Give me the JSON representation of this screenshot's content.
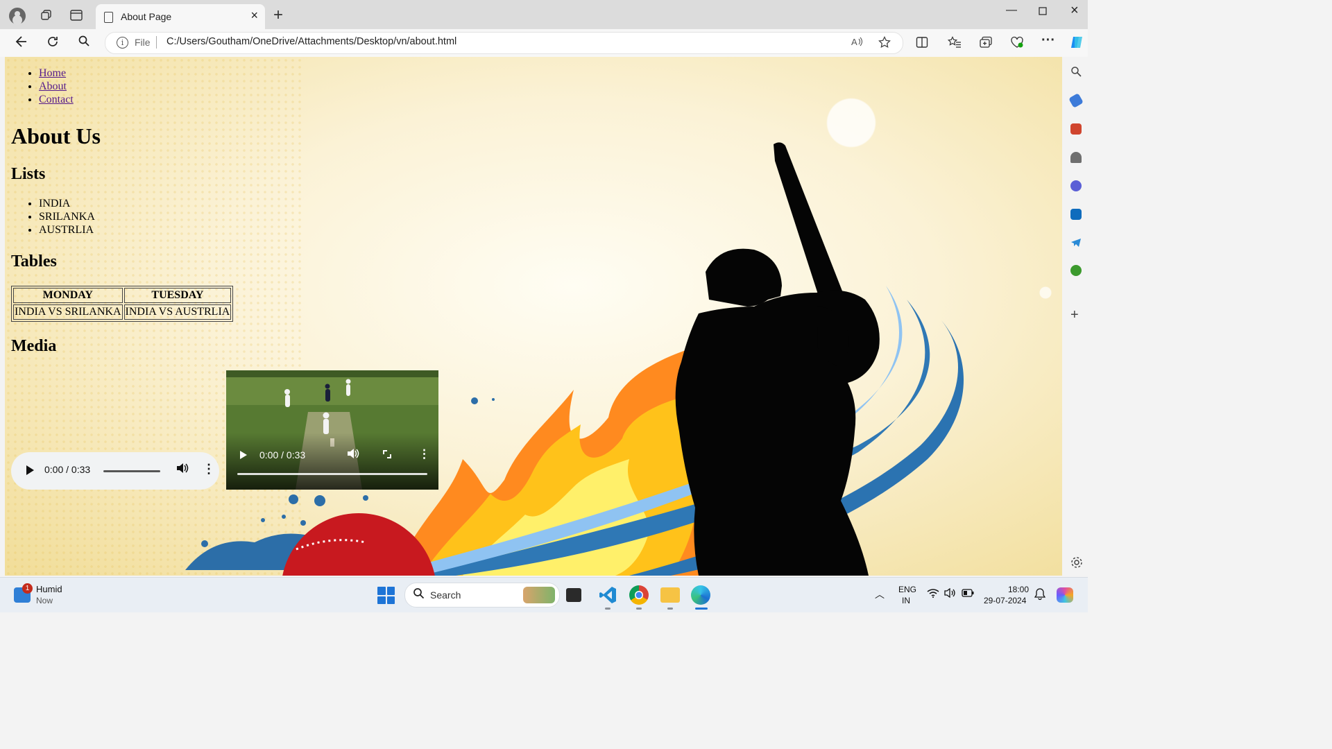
{
  "browser": {
    "tab_title": "About Page",
    "address_prefix": "File",
    "url": "C:/Users/Goutham/OneDrive/Attachments/Desktop/vn/about.html"
  },
  "page": {
    "nav_links": [
      "Home",
      "About",
      "Contact"
    ],
    "heading": "About Us",
    "lists_heading": "Lists",
    "list_items": [
      "INDIA",
      "SRILANKA",
      "AUSTRLIA"
    ],
    "tables_heading": "Tables",
    "table_headers": [
      "MONDAY",
      "TUESDAY"
    ],
    "table_rows": [
      [
        "INDIA VS SRILANKA",
        "INDIA VS AUSTRLIA"
      ]
    ],
    "media_heading": "Media",
    "audio": {
      "time": "0:00 / 0:33"
    },
    "video": {
      "time": "0:00 / 0:33"
    }
  },
  "taskbar": {
    "weather_badge": "1",
    "weather_title": "Humid",
    "weather_sub": "Now",
    "search_label": "Search",
    "lang_top": "ENG",
    "lang_bottom": "IN",
    "time": "18:00",
    "date": "29-07-2024"
  },
  "colors": {
    "link": "#551a8b",
    "accent_blue": "#1e74d6",
    "page_bg_warm": "#f1dd98"
  }
}
